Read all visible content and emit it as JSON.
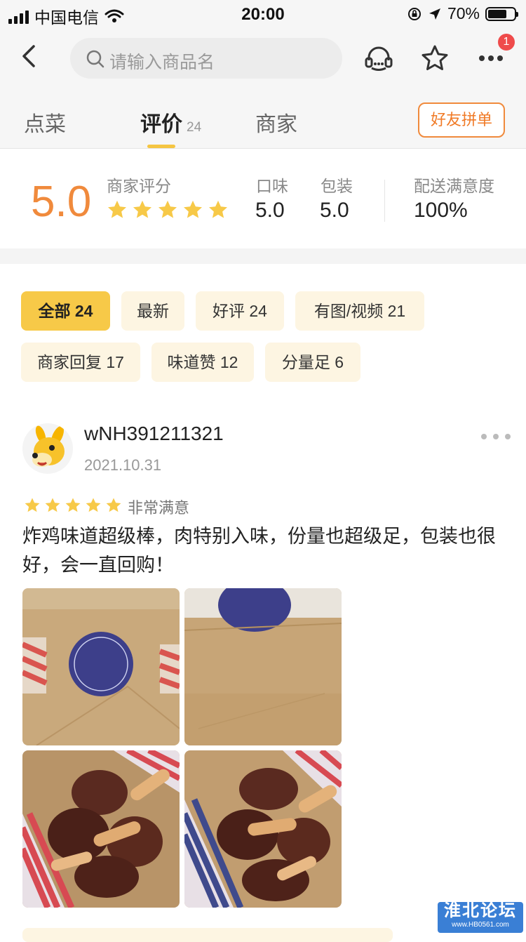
{
  "status_bar": {
    "carrier": "中国电信",
    "time": "20:00",
    "battery": "70%"
  },
  "search": {
    "placeholder": "请输入商品名"
  },
  "header": {
    "notification_count": "1"
  },
  "tabs": [
    {
      "label": "点菜"
    },
    {
      "label": "评价",
      "count": "24"
    },
    {
      "label": "商家"
    }
  ],
  "group_order_label": "好友拼单",
  "summary": {
    "score": "5.0",
    "score_label": "商家评分",
    "stars": 5,
    "taste_label": "口味",
    "taste_value": "5.0",
    "package_label": "包装",
    "package_value": "5.0",
    "delivery_label": "配送满意度",
    "delivery_value": "100%"
  },
  "filters": [
    {
      "label": "全部 24",
      "active": true
    },
    {
      "label": "最新",
      "active": false
    },
    {
      "label": "好评 24",
      "active": false
    },
    {
      "label": "有图/视频 21",
      "active": false
    },
    {
      "label": "商家回复 17",
      "active": false
    },
    {
      "label": "味道赞 12",
      "active": false
    },
    {
      "label": "分量足 6",
      "active": false
    }
  ],
  "review": {
    "username": "wNH391211321",
    "date": "2021.10.31",
    "stars": 5,
    "rating_text": "非常满意",
    "content": "炸鸡味道超级棒，肉特别入味，份量也超级足，包装也很好，会一直回购！"
  },
  "watermark": {
    "title": "淮北论坛",
    "url": "www.HB0561.com"
  },
  "colors": {
    "accent": "#f08a3c",
    "star": "#f7c948",
    "chip_bg": "#fdf5e2",
    "badge": "#ef4b4b"
  }
}
